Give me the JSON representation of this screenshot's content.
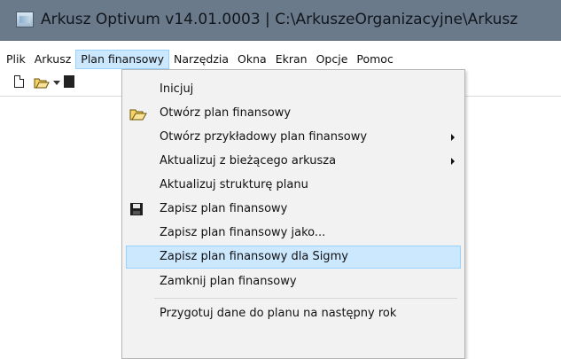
{
  "window": {
    "title": "Arkusz Optivum v14.01.0003  | C:\\ArkuszeOrganizacyjne\\Arkusz"
  },
  "menubar": {
    "items": [
      {
        "label": "Plik"
      },
      {
        "label": "Arkusz"
      },
      {
        "label": "Plan finansowy"
      },
      {
        "label": "Narzędzia"
      },
      {
        "label": "Okna"
      },
      {
        "label": "Ekran"
      },
      {
        "label": "Opcje"
      },
      {
        "label": "Pomoc"
      }
    ]
  },
  "toolbar": {
    "icons": [
      "new-document-icon",
      "open-folder-icon",
      "dropdown-arrow-icon",
      "save-disk-icon"
    ]
  },
  "dropdown": {
    "items": [
      {
        "label": "Inicjuj"
      },
      {
        "label": "Otwórz plan finansowy",
        "icon": "open-folder-icon"
      },
      {
        "label": "Otwórz przykładowy plan finansowy",
        "submenu": true
      },
      {
        "label": "Aktualizuj z bieżącego arkusza",
        "submenu": true
      },
      {
        "label": "Aktualizuj strukturę planu"
      },
      {
        "label": "Zapisz plan finansowy",
        "icon": "save-disk-icon"
      },
      {
        "label": "Zapisz plan finansowy jako..."
      },
      {
        "label": "Zapisz plan finansowy dla Sigmy",
        "highlighted": true
      },
      {
        "label": "Zamknij plan finansowy"
      },
      {
        "label": "Przygotuj dane do planu na następny rok"
      }
    ]
  },
  "colors": {
    "titlebar": "#6b7a8b",
    "highlight_bg": "#cce8ff",
    "highlight_border": "#99d1ff"
  }
}
